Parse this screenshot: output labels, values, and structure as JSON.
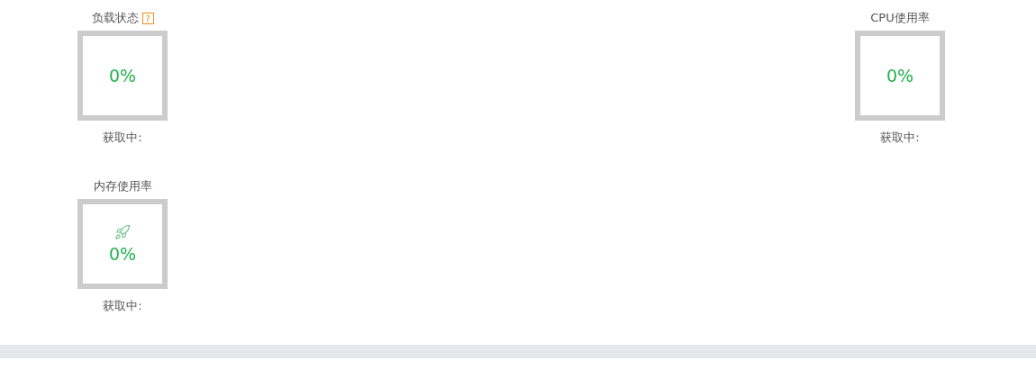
{
  "rows": [
    {
      "gauges": [
        {
          "title": "负载状态",
          "help": "?",
          "kind": "plain",
          "value": "0%",
          "status": "获取中:"
        },
        {
          "title": "CPU使用率",
          "kind": "plain",
          "value": "0%",
          "status": "获取中:"
        }
      ]
    },
    {
      "gauges": [
        {
          "title": "内存使用率",
          "kind": "rocket",
          "value": "0%",
          "status": "获取中:"
        }
      ]
    }
  ]
}
